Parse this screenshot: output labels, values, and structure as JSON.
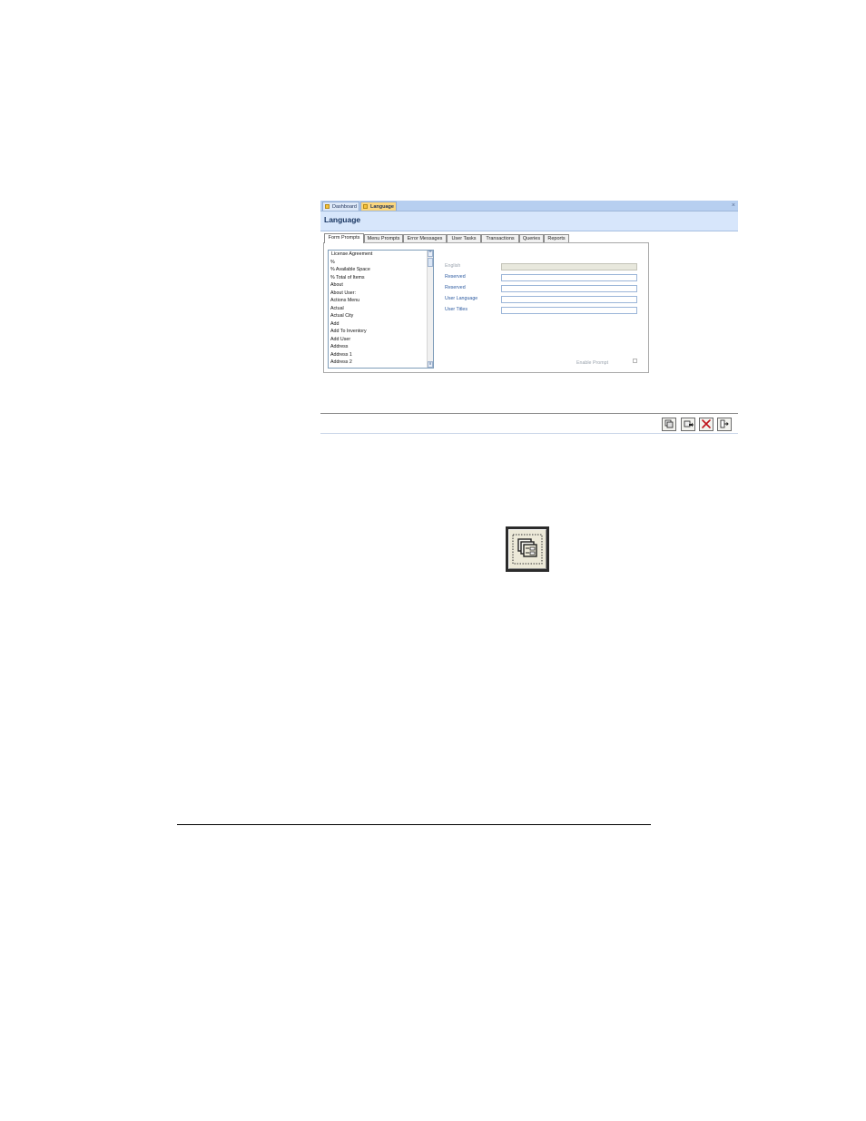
{
  "doc_tabs": [
    {
      "label": "Dashboard",
      "active": false
    },
    {
      "label": "Language",
      "active": true
    }
  ],
  "doc_close_glyph": "×",
  "form": {
    "title": "Language"
  },
  "tabs": [
    "Form Prompts",
    "Menu Prompts",
    "Error Messages",
    "User Tasks",
    "Transactions",
    "Queries",
    "Reports"
  ],
  "active_tab": "Form Prompts",
  "prompt_list": [
    "License Agreement",
    "%",
    "% Available Space",
    "% Total of Items",
    "About",
    "About User:",
    "Actions Menu",
    "Actual",
    "Actual City",
    "Add",
    "Add To Inventory",
    "Add User",
    "Address",
    "Address 1",
    "Address 2"
  ],
  "fields": {
    "english": {
      "label": "English",
      "value": "",
      "disabled": true
    },
    "reserved1": {
      "label": "Reserved",
      "value": ""
    },
    "reserved2": {
      "label": "Reserved",
      "value": ""
    },
    "user_language": {
      "label": "User Language",
      "value": ""
    },
    "user_titles": {
      "label": "User Titles",
      "value": ""
    }
  },
  "enable_prompt": {
    "label": "Enable Prompt",
    "checked": false
  },
  "toolbar_icons": [
    "copy-records-icon",
    "apply-icon",
    "delete-icon",
    "exit-icon"
  ],
  "scroll_glyphs": {
    "up": "^",
    "down": "v"
  },
  "colors": {
    "accent_tab": "#fbd77e",
    "header_bg": "#d7e6fb",
    "label_blue": "#2c5aa0",
    "delete_red": "#c0141c"
  }
}
